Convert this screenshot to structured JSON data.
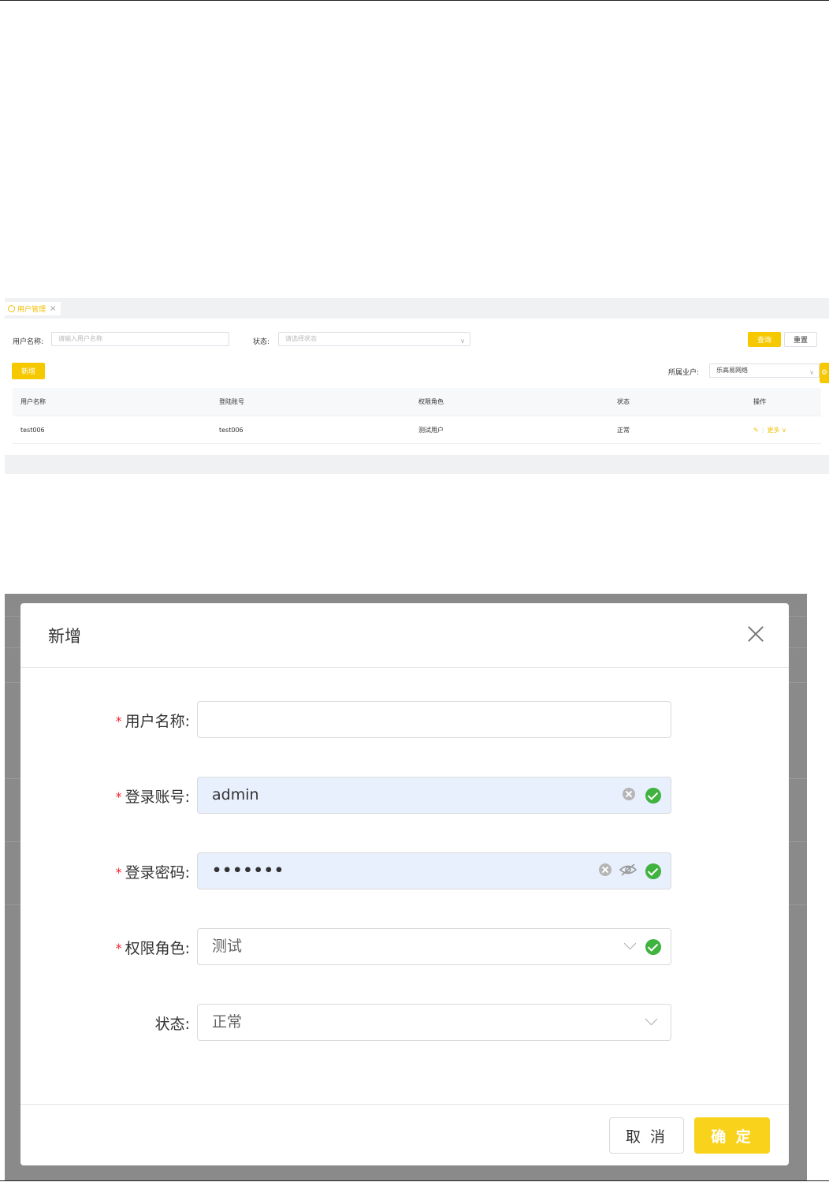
{
  "list_view": {
    "tab": {
      "label": "用户管理",
      "close": "×"
    },
    "search": {
      "name_label": "用户名称:",
      "name_placeholder": "请输入用户名称",
      "status_label": "状态:",
      "status_placeholder": "请选择状态"
    },
    "buttons": {
      "query": "查询",
      "reset": "重置",
      "add": "新增"
    },
    "tenant": {
      "label": "所属业户:",
      "value": "乐高易网络"
    },
    "table": {
      "headers": [
        "用户名称",
        "登陆账号",
        "权限角色",
        "状态",
        "操作"
      ],
      "rows": [
        {
          "name": "test006",
          "account": "test006",
          "role": "测试用户",
          "status": "正常",
          "more": "更多"
        }
      ]
    }
  },
  "modal": {
    "title": "新增",
    "fields": {
      "username": {
        "label": "用户名称:",
        "required": "*",
        "value": ""
      },
      "account": {
        "label": "登录账号:",
        "required": "*",
        "value": "admin"
      },
      "password": {
        "label": "登录密码:",
        "required": "*",
        "value": "•••••••"
      },
      "role": {
        "label": "权限角色:",
        "required": "*",
        "value": "测试"
      },
      "status": {
        "label": "状态:",
        "value": "正常"
      }
    },
    "buttons": {
      "cancel": "取 消",
      "confirm": "确 定"
    }
  },
  "colors": {
    "accent": "#f5c800",
    "success": "#3fb23f",
    "required": "#f5222d",
    "overlay": "#8a8a8a"
  }
}
